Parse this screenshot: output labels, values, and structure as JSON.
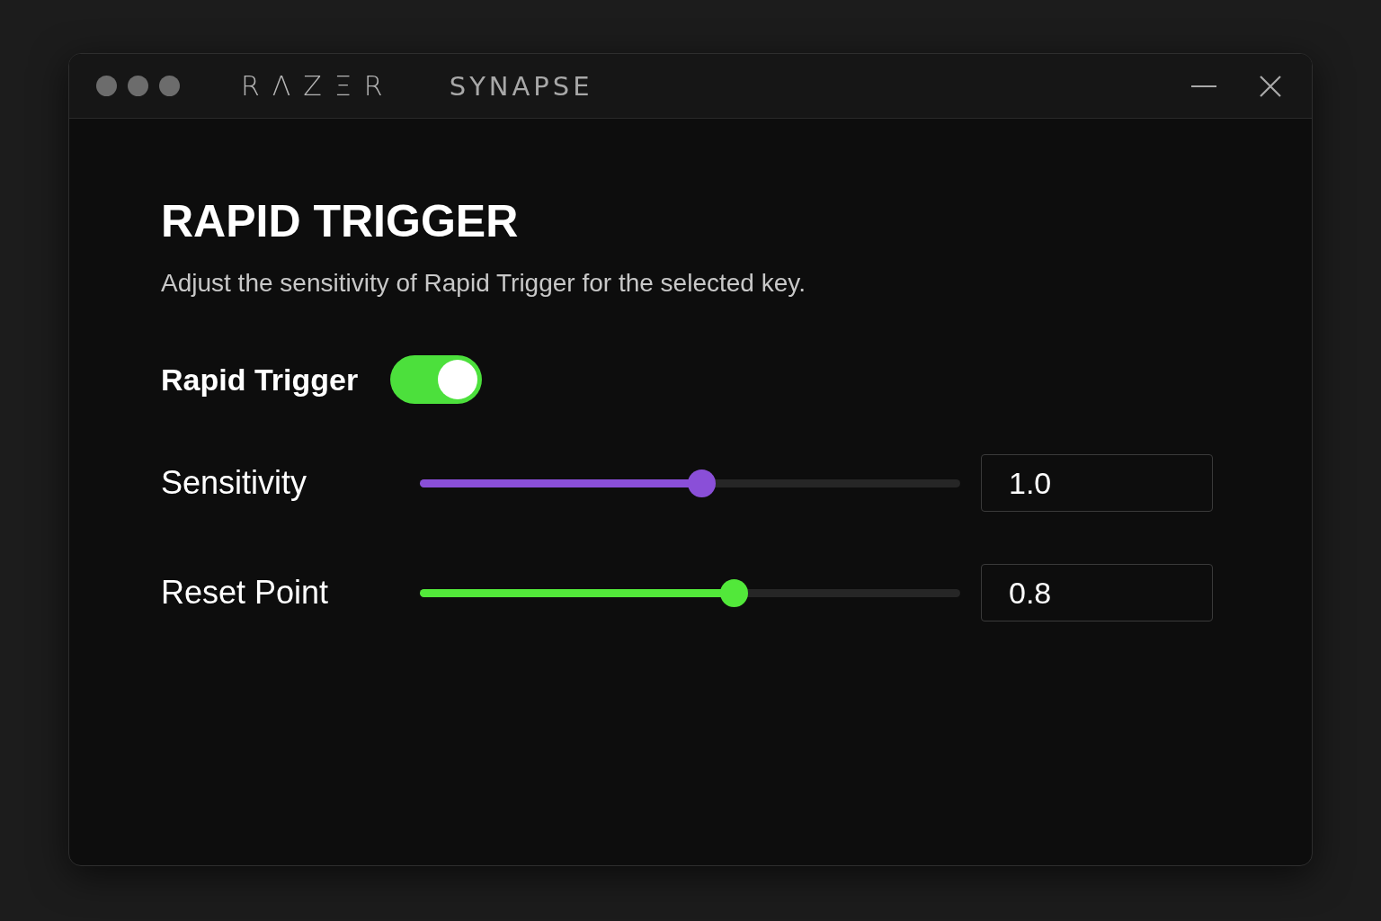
{
  "window": {
    "logo": "RΛZΞR",
    "title": "SYNAPSE"
  },
  "heading": "RAPID TRIGGER",
  "description": "Adjust the sensitivity of Rapid Trigger for the selected key.",
  "toggle": {
    "label": "Rapid Trigger",
    "on": true
  },
  "sliders": [
    {
      "label": "Sensitivity",
      "level": 0.52,
      "value": "1.0",
      "color": "#8a4fd8"
    },
    {
      "label": "Reset Point",
      "level": 0.58,
      "value": "0.8",
      "color": "#52e83a"
    }
  ]
}
